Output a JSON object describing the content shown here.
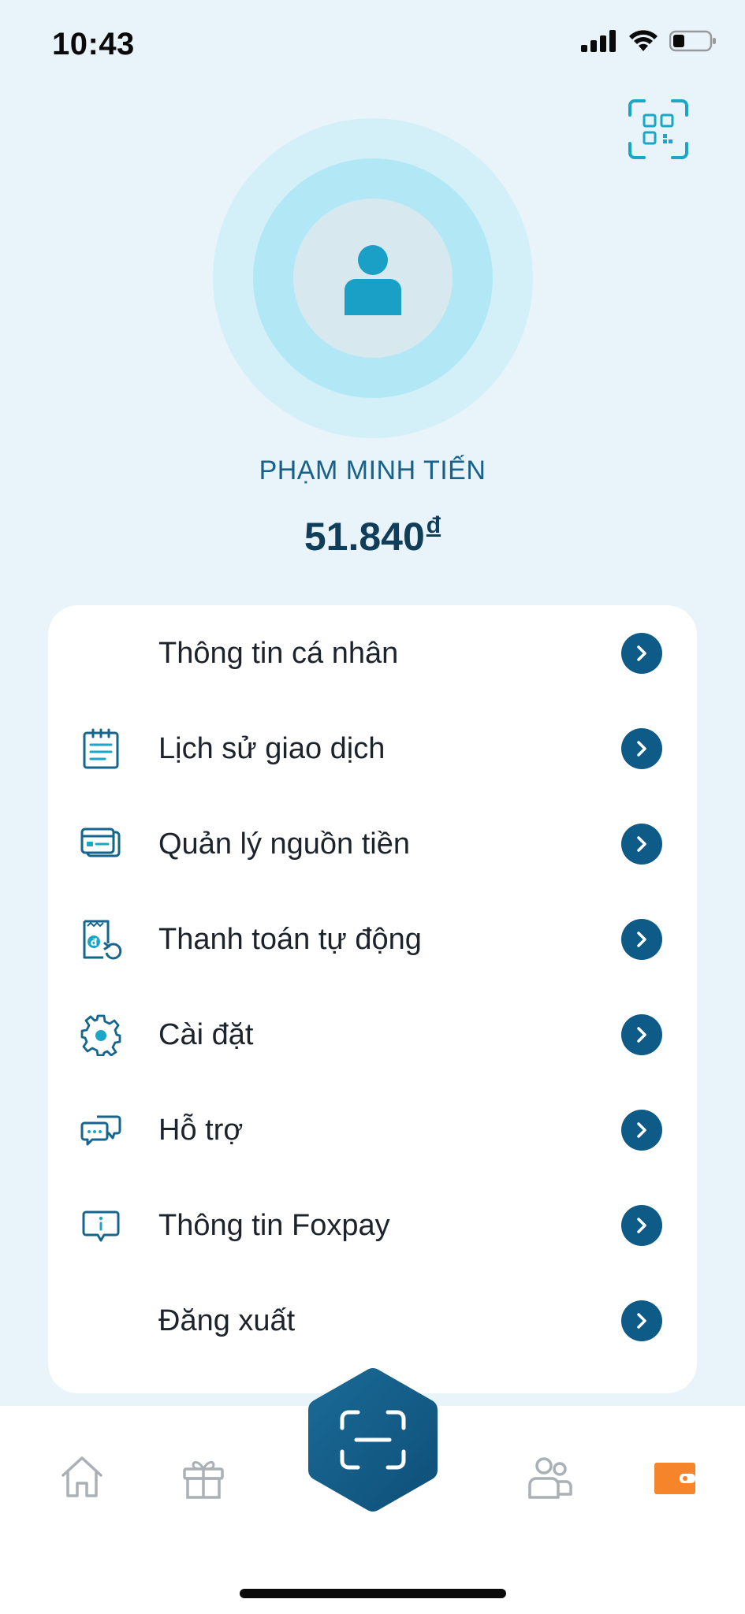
{
  "status_bar": {
    "time": "10:43",
    "icons": [
      "signal-icon",
      "wifi-icon",
      "battery-icon"
    ]
  },
  "header": {
    "qr_icon": "qr-code-icon"
  },
  "profile": {
    "name": "PHẠM MINH TIẾN",
    "balance": "51.840",
    "currency": "đ"
  },
  "menu": {
    "items": [
      {
        "label": "Thông tin cá nhân",
        "icon": ""
      },
      {
        "label": "Lịch sử giao dịch",
        "icon": "clipboard-list-icon"
      },
      {
        "label": "Quản lý nguồn tiền",
        "icon": "card-icon"
      },
      {
        "label": "Thanh toán tự động",
        "icon": "auto-payment-icon"
      },
      {
        "label": "Cài đặt",
        "icon": "gear-icon"
      },
      {
        "label": "Hỗ trợ",
        "icon": "chat-support-icon"
      },
      {
        "label": "Thông tin Foxpay",
        "icon": "info-message-icon"
      },
      {
        "label": "Đăng xuất",
        "icon": ""
      }
    ]
  },
  "bottom_nav": {
    "items": [
      "home-icon",
      "gift-icon",
      "scan-icon",
      "people-icon",
      "wallet-icon"
    ],
    "active": "wallet-icon"
  },
  "colors": {
    "background": "#e8f4fa",
    "primary": "#0e5b87",
    "accent_cyan": "#1aa6c6",
    "wallet_orange": "#f5842a",
    "nav_inactive": "#a9b0b6"
  }
}
